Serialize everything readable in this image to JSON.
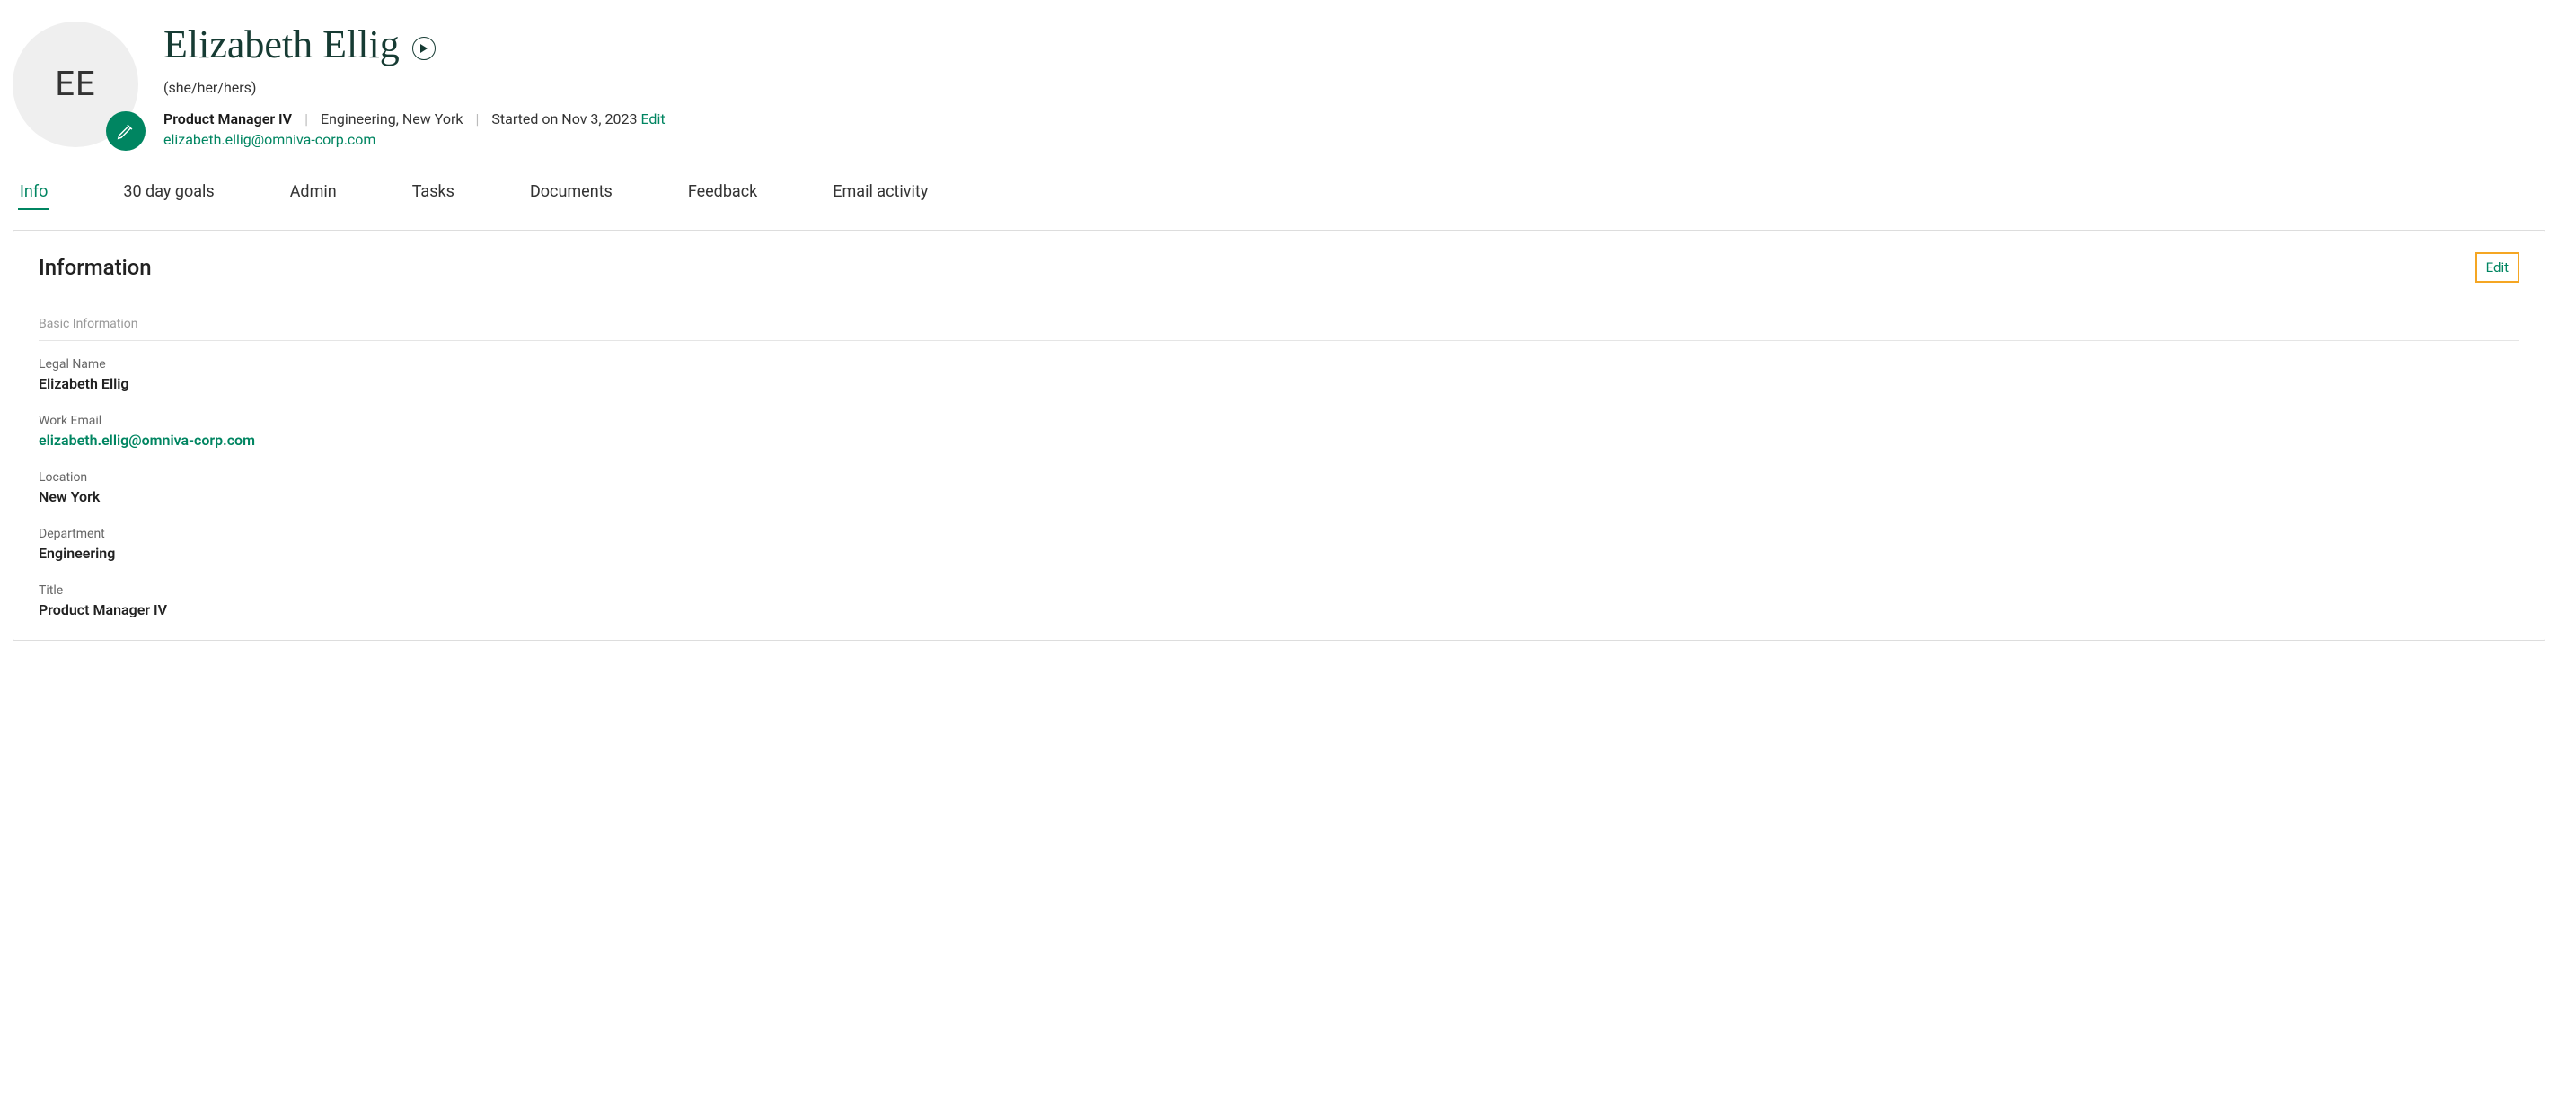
{
  "header": {
    "initials": "EE",
    "name": "Elizabeth Ellig",
    "pronouns": "(she/her/hers)",
    "title": "Product Manager IV",
    "dept_loc": "Engineering, New York",
    "started": "Started on Nov 3, 2023",
    "edit_label": "Edit",
    "email": "elizabeth.ellig@omniva-corp.com"
  },
  "tabs": {
    "info": "Info",
    "goals": "30 day goals",
    "admin": "Admin",
    "tasks": "Tasks",
    "documents": "Documents",
    "feedback": "Feedback",
    "email": "Email activity"
  },
  "panel": {
    "title": "Information",
    "edit": "Edit",
    "section_label": "Basic Information",
    "fields": {
      "legal_name_label": "Legal Name",
      "legal_name_value": "Elizabeth Ellig",
      "work_email_label": "Work Email",
      "work_email_value": "elizabeth.ellig@omniva-corp.com",
      "location_label": "Location",
      "location_value": "New York",
      "department_label": "Department",
      "department_value": "Engineering",
      "title_label": "Title",
      "title_value": "Product Manager IV"
    }
  }
}
